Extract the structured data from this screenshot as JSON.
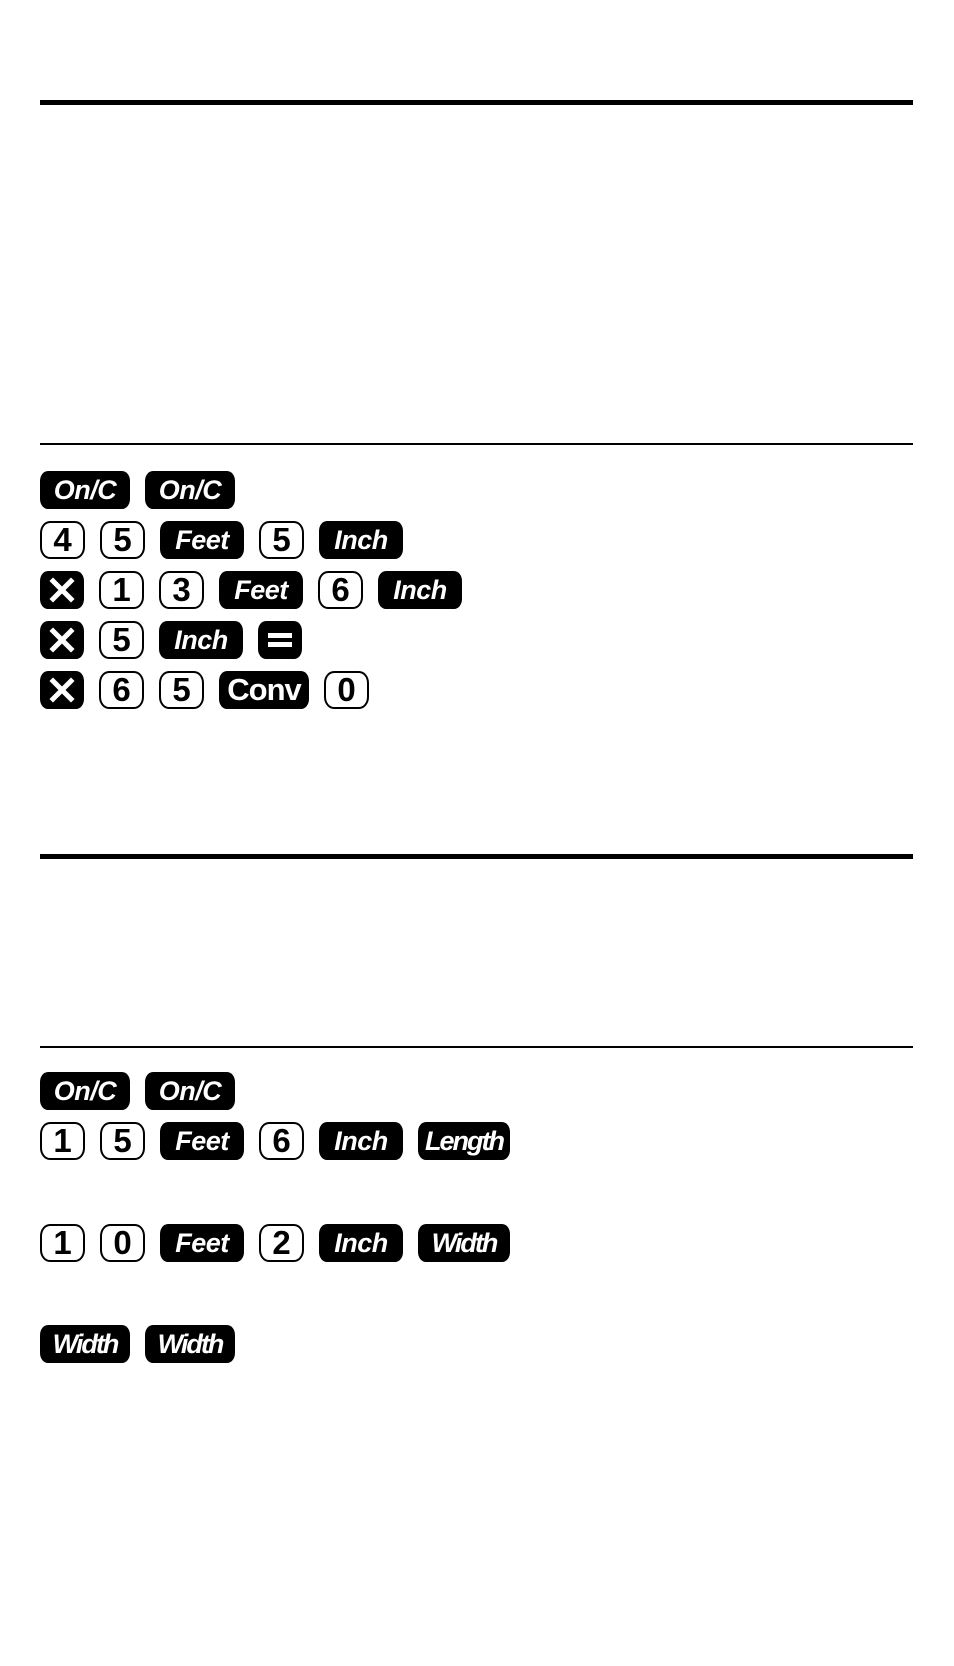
{
  "document": {
    "example_1": {
      "steps": [
        [
          "On/C",
          "On/C"
        ],
        [
          "4",
          "5",
          "Feet",
          "5",
          "Inch"
        ],
        [
          "×",
          "1",
          "3",
          "Feet",
          "6",
          "Inch"
        ],
        [
          "×",
          "5",
          "Inch",
          "="
        ],
        [
          "×",
          "6",
          "5",
          "Conv",
          "0"
        ]
      ]
    },
    "example_2": {
      "steps": [
        [
          "On/C",
          "On/C"
        ],
        [
          "1",
          "5",
          "Feet",
          "6",
          "Inch",
          "Length"
        ],
        [
          "1",
          "0",
          "Feet",
          "2",
          "Inch",
          "Width"
        ],
        [
          "Width",
          "Width"
        ]
      ]
    }
  },
  "keys": {
    "on_c": "On/C",
    "feet": "Feet",
    "inch": "Inch",
    "conv": "Conv",
    "length": "Length",
    "width": "Width",
    "d0": "0",
    "d1": "1",
    "d2": "2",
    "d3": "3",
    "d4": "4",
    "d5": "5",
    "d6": "6",
    "multiply_icon": "multiply-icon",
    "equals_icon": "equals-icon"
  }
}
